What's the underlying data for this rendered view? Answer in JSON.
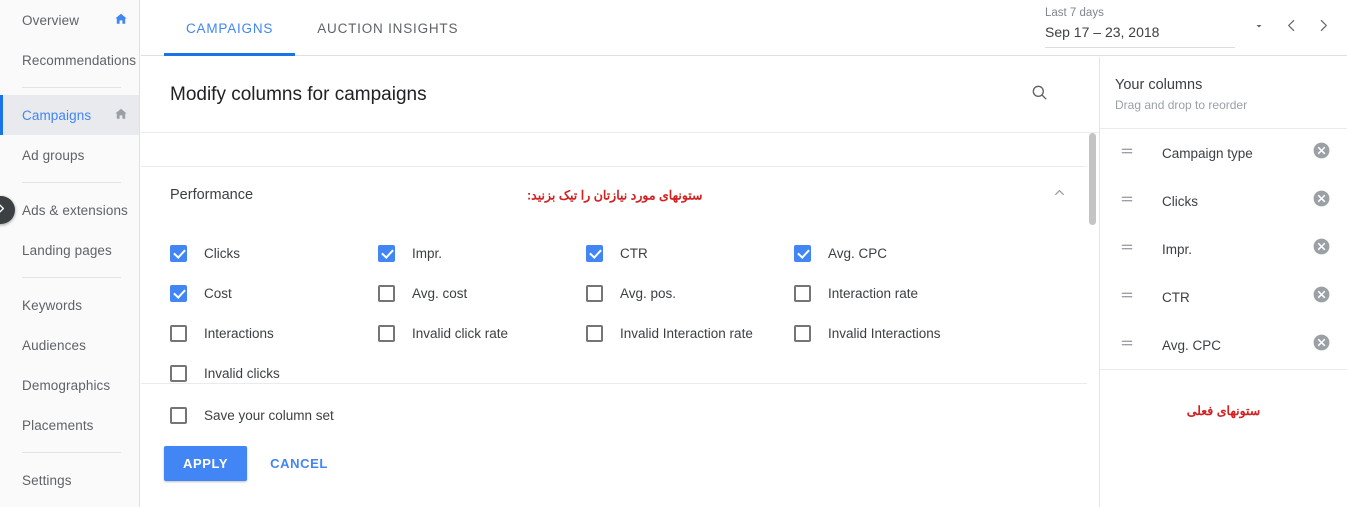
{
  "sidebar": {
    "items": [
      {
        "label": "Overview",
        "icon": "home-icon",
        "icon_color": "#4285f4",
        "active": false,
        "sep_after": false
      },
      {
        "label": "Recommendations",
        "icon": null,
        "active": false,
        "sep_after": true
      },
      {
        "label": "Campaigns",
        "icon": "home-icon",
        "icon_color": "#9aa0a6",
        "active": true,
        "sep_after": false
      },
      {
        "label": "Ad groups",
        "icon": null,
        "active": false,
        "sep_after": true
      },
      {
        "label": "Ads & extensions",
        "icon": null,
        "active": false,
        "sep_after": false
      },
      {
        "label": "Landing pages",
        "icon": null,
        "active": false,
        "sep_after": true
      },
      {
        "label": "Keywords",
        "icon": null,
        "active": false,
        "sep_after": false
      },
      {
        "label": "Audiences",
        "icon": null,
        "active": false,
        "sep_after": false
      },
      {
        "label": "Demographics",
        "icon": null,
        "active": false,
        "sep_after": false
      },
      {
        "label": "Placements",
        "icon": null,
        "active": false,
        "sep_after": true
      },
      {
        "label": "Settings",
        "icon": null,
        "active": false,
        "sep_after": false
      }
    ],
    "expand_handle_icon": "chevron-right-icon"
  },
  "topbar": {
    "tabs": [
      {
        "label": "CAMPAIGNS",
        "active": true
      },
      {
        "label": "AUCTION INSIGHTS",
        "active": false
      }
    ],
    "date_range": {
      "label": "Last 7 days",
      "value": "Sep 17 – 23, 2018",
      "dropdown_icon": "caret-down-icon",
      "prev_icon": "chevron-left-icon",
      "next_icon": "chevron-right-icon"
    }
  },
  "main": {
    "title": "Modify columns for campaigns",
    "search_icon": "search-icon",
    "section": {
      "title": "Performance",
      "note": "ستونهای مورد نیازتان را تیک بزنید:",
      "collapse_icon": "chevron-up-icon"
    },
    "checkboxes": [
      {
        "label": "Clicks",
        "checked": true
      },
      {
        "label": "Impr.",
        "checked": true
      },
      {
        "label": "CTR",
        "checked": true
      },
      {
        "label": "Avg. CPC",
        "checked": true
      },
      {
        "label": "Cost",
        "checked": true
      },
      {
        "label": "Avg. cost",
        "checked": false
      },
      {
        "label": "Avg. pos.",
        "checked": false
      },
      {
        "label": "Interaction rate",
        "checked": false
      },
      {
        "label": "Interactions",
        "checked": false
      },
      {
        "label": "Invalid click rate",
        "checked": false
      },
      {
        "label": "Invalid Interaction rate",
        "checked": false
      },
      {
        "label": "Invalid Interactions",
        "checked": false
      },
      {
        "label": "Invalid clicks",
        "checked": false
      }
    ],
    "footer": {
      "save_label": "Save your column set",
      "save_checked": false,
      "apply_label": "APPLY",
      "cancel_label": "CANCEL"
    }
  },
  "right": {
    "title": "Your columns",
    "subtitle": "Drag and drop to reorder",
    "columns": [
      {
        "label": "Campaign type",
        "drag_icon": "drag-handle-icon",
        "remove_icon": "remove-circle-icon"
      },
      {
        "label": "Clicks",
        "drag_icon": "drag-handle-icon",
        "remove_icon": "remove-circle-icon"
      },
      {
        "label": "Impr.",
        "drag_icon": "drag-handle-icon",
        "remove_icon": "remove-circle-icon"
      },
      {
        "label": "CTR",
        "drag_icon": "drag-handle-icon",
        "remove_icon": "remove-circle-icon"
      },
      {
        "label": "Avg. CPC",
        "drag_icon": "drag-handle-icon",
        "remove_icon": "remove-circle-icon"
      }
    ],
    "note": "ستونهای فعلی"
  },
  "colors": {
    "accent": "#4285f4",
    "accent_dark": "#1a73e8",
    "annotation_red": "#d32020",
    "text": "#3c4043",
    "muted": "#9aa0a6"
  }
}
